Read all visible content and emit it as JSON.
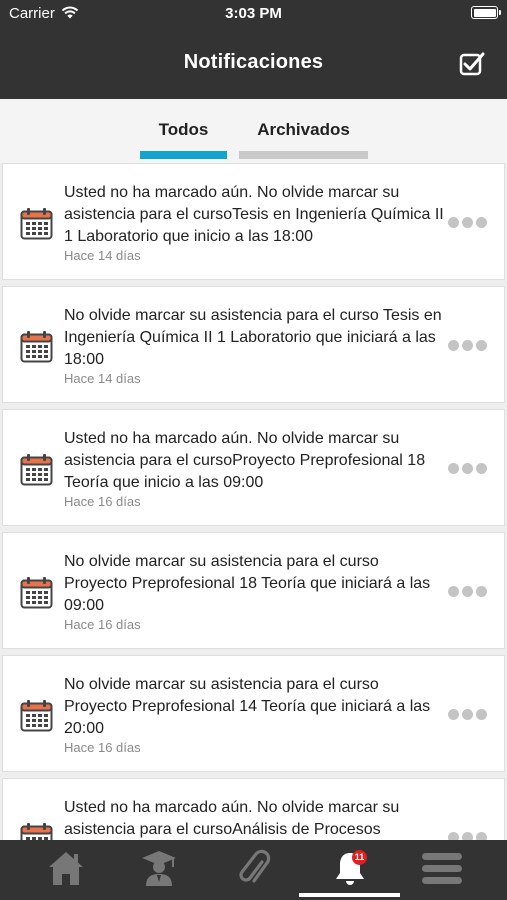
{
  "status_bar": {
    "carrier": "Carrier",
    "time": "3:03 PM"
  },
  "nav": {
    "title": "Notificaciones"
  },
  "tabs": [
    {
      "label": "Todos",
      "selected": true
    },
    {
      "label": "Archivados",
      "selected": false
    }
  ],
  "notifications": [
    {
      "message": "Usted no ha marcado aún. No olvide marcar su asistencia para el cursoTesis en Ingeniería Química II 1 Laboratorio que inicio a las 18:00",
      "ago": "Hace 14 días"
    },
    {
      "message": "No olvide marcar su asistencia para el curso Tesis en Ingeniería Química II 1 Laboratorio que iniciará a las 18:00",
      "ago": "Hace 14 días"
    },
    {
      "message": "Usted no ha marcado aún. No olvide marcar su asistencia para el cursoProyecto Preprofesional 18 Teoría que inicio a las 09:00",
      "ago": "Hace 16 días"
    },
    {
      "message": "No olvide marcar su asistencia para el curso Proyecto Preprofesional 18 Teoría que iniciará a las 09:00",
      "ago": "Hace 16 días"
    },
    {
      "message": "No olvide marcar su asistencia para el curso Proyecto Preprofesional 14 Teoría que iniciará a las 20:00",
      "ago": "Hace 16 días"
    },
    {
      "message": "Usted no ha marcado aún. No olvide marcar su asistencia para el cursoAnálisis de Procesos",
      "ago": ""
    }
  ],
  "bottom_tabs": [
    {
      "icon": "home-icon"
    },
    {
      "icon": "graduate-icon"
    },
    {
      "icon": "paperclip-icon"
    },
    {
      "icon": "bell-icon",
      "badge": "11",
      "active": true
    },
    {
      "icon": "menu-icon"
    }
  ],
  "colors": {
    "bar": "#333333",
    "accent": "#13a3cf",
    "badge": "#e02020"
  }
}
